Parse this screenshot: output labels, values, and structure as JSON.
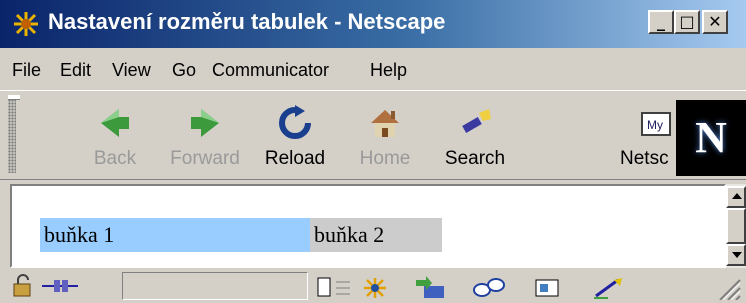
{
  "window": {
    "title": "Nastavení rozměru tabulek - Netscape",
    "controls": {
      "minimize": "_",
      "maximize": "□",
      "close": "✕"
    }
  },
  "menu": [
    "File",
    "Edit",
    "View",
    "Go",
    "Communicator",
    "Help"
  ],
  "toolbar": {
    "buttons": [
      {
        "label": "Back",
        "enabled": false,
        "icon": "back-arrow-icon"
      },
      {
        "label": "Forward",
        "enabled": false,
        "icon": "forward-arrow-icon"
      },
      {
        "label": "Reload",
        "enabled": true,
        "icon": "reload-icon"
      },
      {
        "label": "Home",
        "enabled": false,
        "icon": "home-icon"
      },
      {
        "label": "Search",
        "enabled": true,
        "icon": "search-flashlight-icon"
      },
      {
        "label": "Netsc",
        "enabled": true,
        "icon": "netscape-my-icon"
      }
    ],
    "logo": "N"
  },
  "content": {
    "table": {
      "cells": [
        {
          "text": "buňka 1",
          "bg": "#99ccff"
        },
        {
          "text": "buňka 2",
          "bg": "#cccccc"
        }
      ]
    }
  },
  "colors": {
    "chrome": "#d4d0c8",
    "title_start": "#0a246a",
    "title_end": "#a6caf0"
  }
}
